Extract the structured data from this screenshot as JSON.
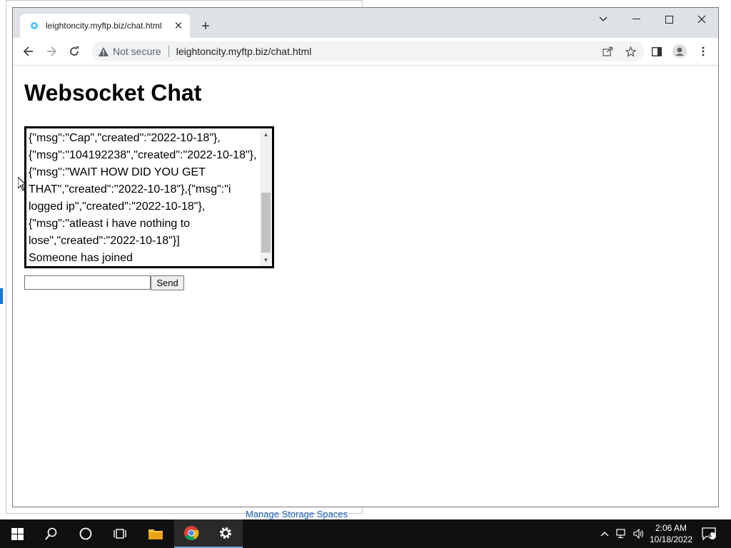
{
  "background": {
    "link_text": "Manage Storage Spaces"
  },
  "browser": {
    "tab": {
      "title": "leightoncity.myftp.biz/chat.html",
      "favicon": "globe-icon"
    },
    "window_controls": [
      "chevron-down-icon",
      "minimize-icon",
      "maximize-icon",
      "close-icon"
    ],
    "omnibox": {
      "security_label": "Not secure",
      "url": "leightoncity.myftp.biz/chat.html"
    }
  },
  "page": {
    "heading": "Websocket Chat",
    "chat_text": "{\"msg\":\"Cap\",\"created\":\"2022-10-18\"},\n{\"msg\":\"104192238\",\"created\":\"2022-10-18\"},\n{\"msg\":\"WAIT HOW DID YOU GET\nTHAT\",\"created\":\"2022-10-18\"},{\"msg\":\"i\nlogged ip\",\"created\":\"2022-10-18\"},\n{\"msg\":\"atleast i have nothing to\nlose\",\"created\":\"2022-10-18\"}]\nSomeone has joined",
    "input_value": "",
    "send_label": "Send"
  },
  "taskbar": {
    "items": [
      "windows-start-icon",
      "search-icon",
      "cortana-icon",
      "task-view-icon",
      "file-explorer-icon",
      "chrome-icon",
      "settings-icon"
    ],
    "clock": {
      "time": "2:06 AM",
      "date": "10/18/2022"
    },
    "notification_count": "1"
  },
  "colors": {
    "accent": "#1a73e8",
    "taskbar": "#101010",
    "tabstrip": "#dee1e6"
  }
}
